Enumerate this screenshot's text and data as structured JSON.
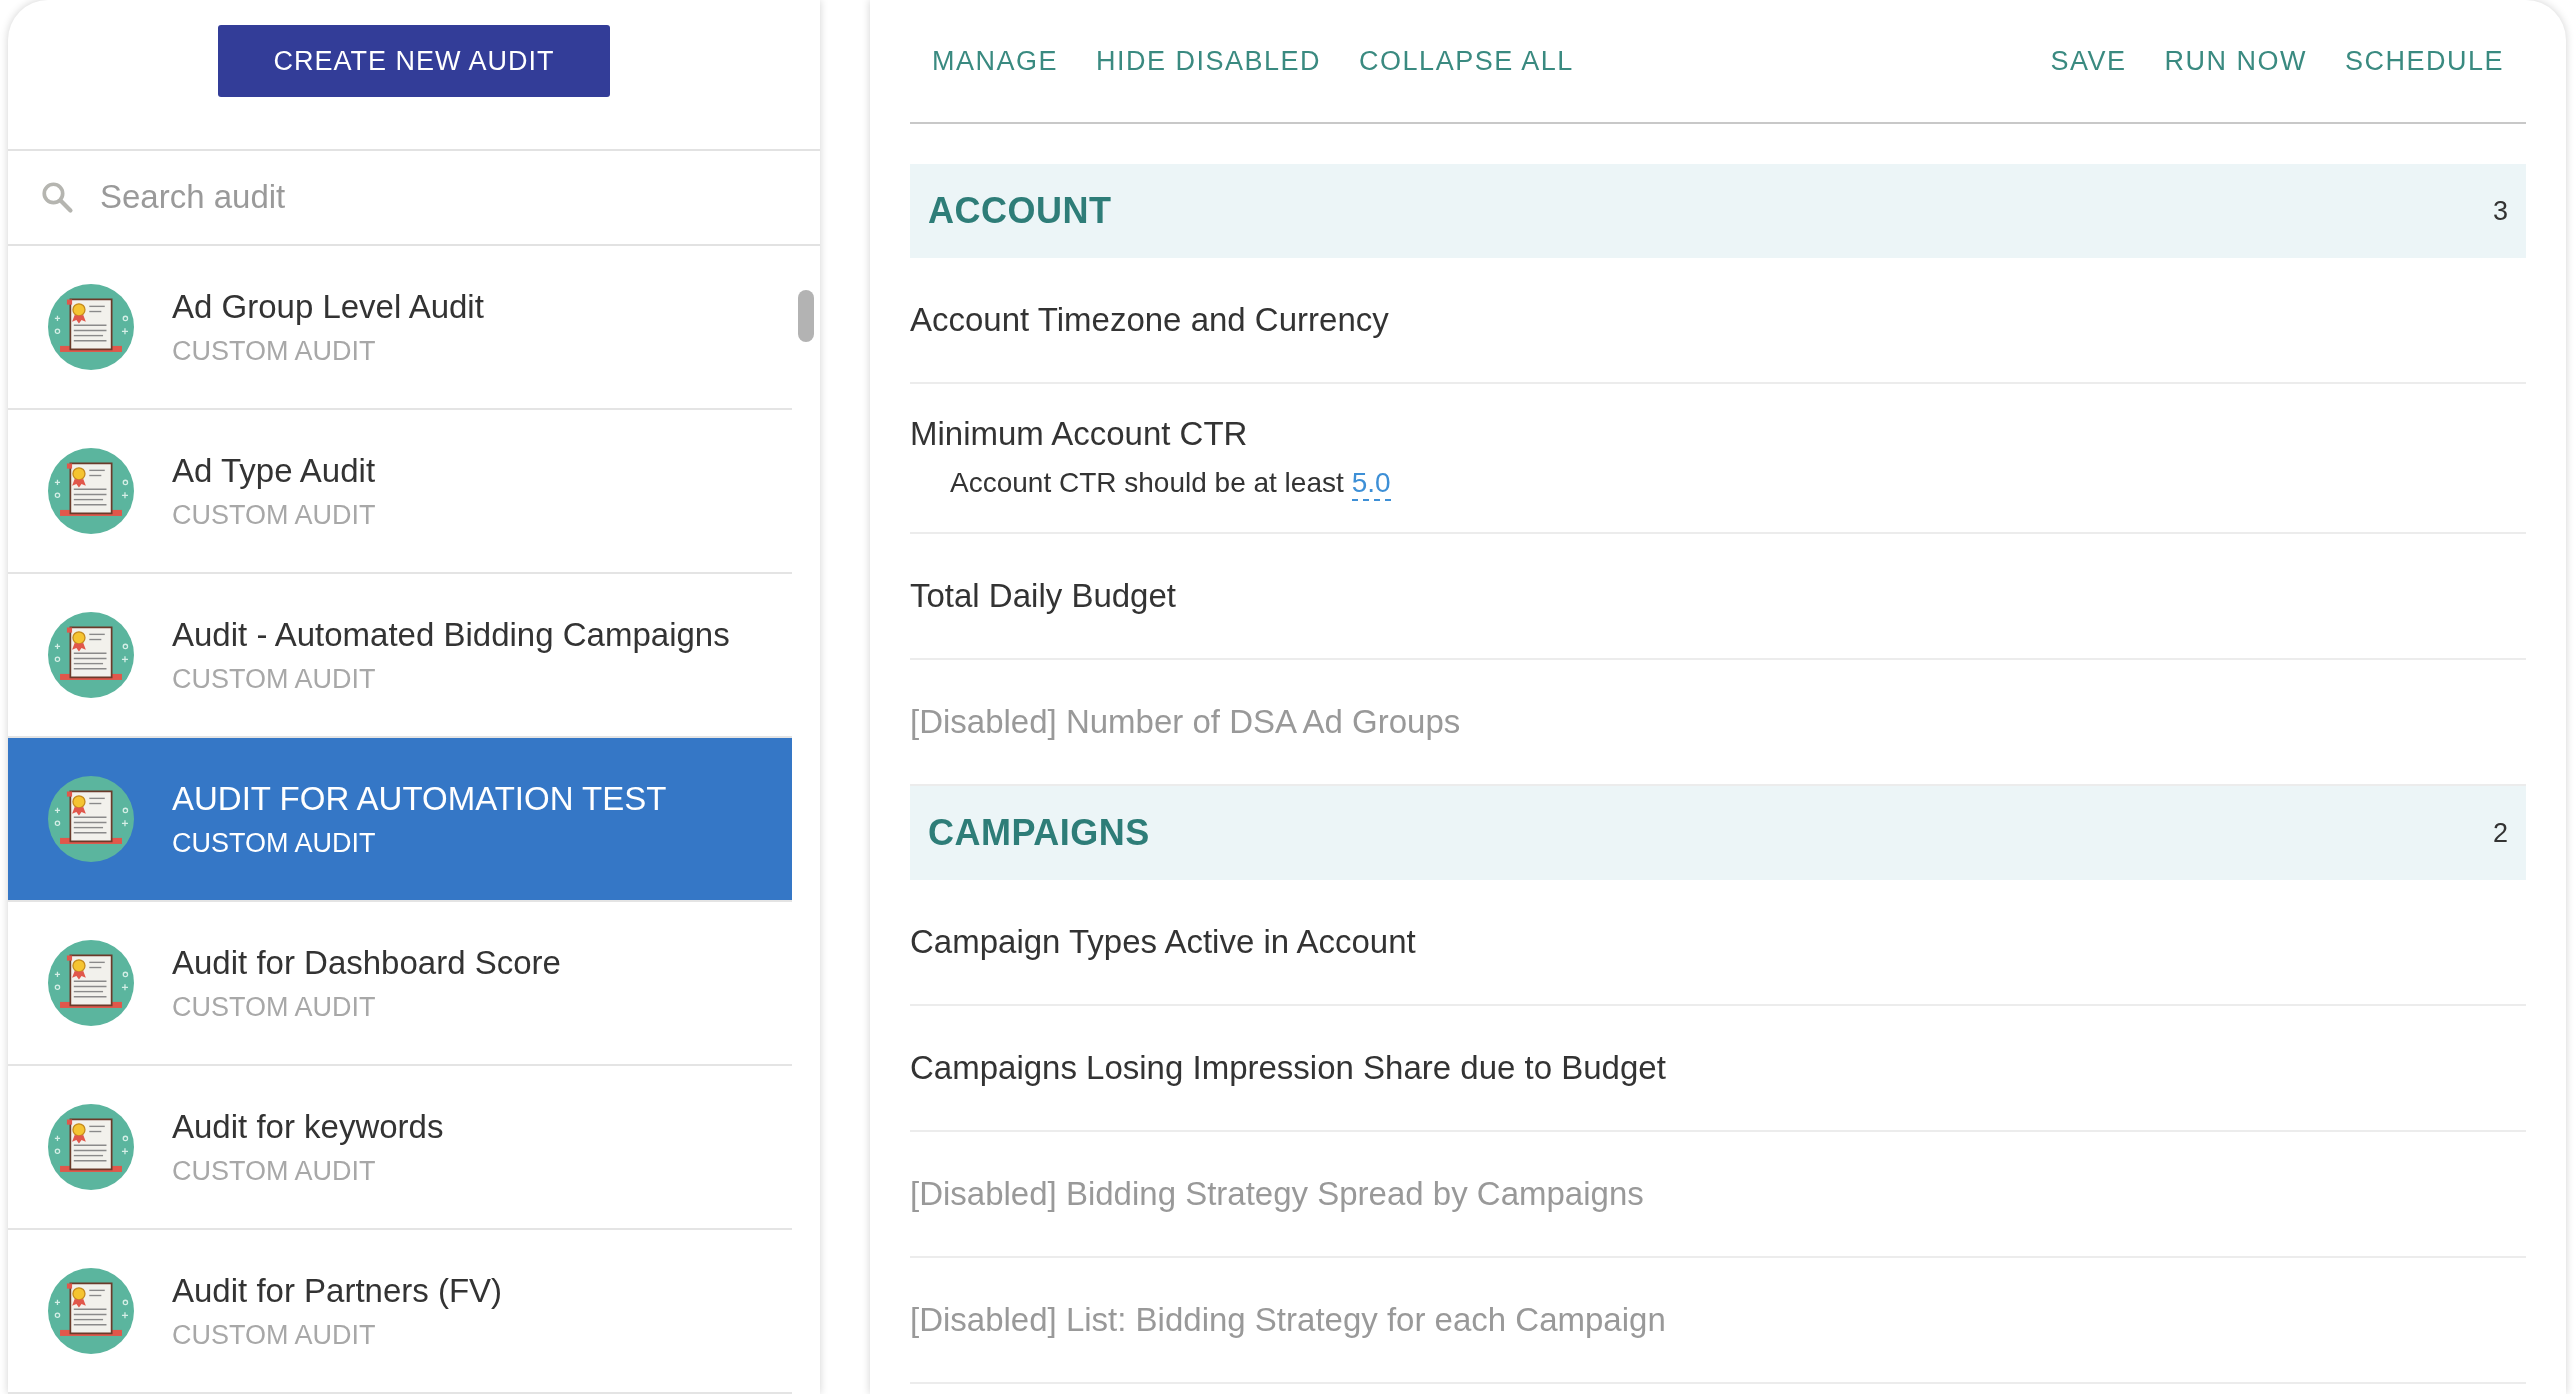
{
  "sidebar": {
    "create_button": "CREATE NEW AUDIT",
    "search": {
      "placeholder": "Search audit"
    },
    "items": [
      {
        "title": "Ad Group Level Audit",
        "subtitle": "CUSTOM AUDIT",
        "selected": false
      },
      {
        "title": "Ad Type Audit",
        "subtitle": "CUSTOM AUDIT",
        "selected": false
      },
      {
        "title": "Audit - Automated Bidding Campaigns",
        "subtitle": "CUSTOM AUDIT",
        "selected": false
      },
      {
        "title": "AUDIT FOR AUTOMATION TEST",
        "subtitle": "CUSTOM AUDIT",
        "selected": true
      },
      {
        "title": "Audit for Dashboard Score",
        "subtitle": "CUSTOM AUDIT",
        "selected": false
      },
      {
        "title": "Audit for keywords",
        "subtitle": "CUSTOM AUDIT",
        "selected": false
      },
      {
        "title": "Audit for Partners (FV)",
        "subtitle": "CUSTOM AUDIT",
        "selected": false
      }
    ]
  },
  "toolbar": {
    "left": [
      "MANAGE",
      "HIDE DISABLED",
      "COLLAPSE ALL"
    ],
    "right": [
      "SAVE",
      "RUN NOW",
      "SCHEDULE"
    ]
  },
  "sections": [
    {
      "title": "ACCOUNT",
      "count": "3",
      "rows": [
        {
          "label": "Account Timezone and Currency",
          "disabled": false
        },
        {
          "label": "Minimum Account CTR",
          "disabled": false,
          "detail": "Account CTR should be at least",
          "value": "5.0"
        },
        {
          "label": "Total Daily Budget",
          "disabled": false
        },
        {
          "label": "[Disabled] Number of DSA Ad Groups",
          "disabled": true
        }
      ]
    },
    {
      "title": "CAMPAIGNS",
      "count": "2",
      "rows": [
        {
          "label": "Campaign Types Active in Account",
          "disabled": false
        },
        {
          "label": "Campaigns Losing Impression Share due to Budget",
          "disabled": false
        },
        {
          "label": "[Disabled] Bidding Strategy Spread by Campaigns",
          "disabled": true
        },
        {
          "label": "[Disabled] List: Bidding Strategy for each Campaign",
          "disabled": true
        }
      ]
    }
  ]
}
